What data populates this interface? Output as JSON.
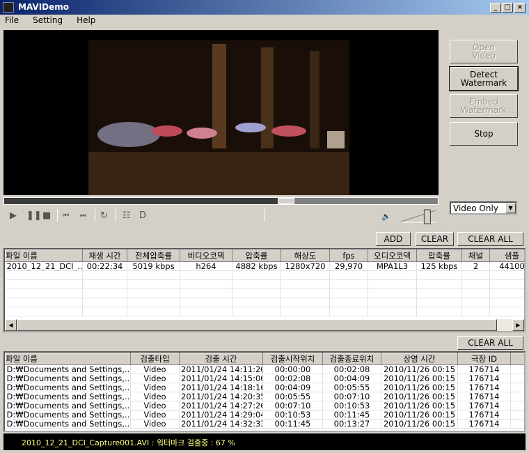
{
  "window": {
    "title": "MAVIDemo",
    "minimize": "_",
    "maximize": "□",
    "close": "×"
  },
  "menu": [
    "File",
    "Setting",
    "Help"
  ],
  "player": {
    "seek_percent": 67,
    "volume_percent": 85,
    "icons": [
      "play-icon",
      "pause-icon",
      "stop-icon",
      "prev-icon",
      "next-icon",
      "repeat-icon",
      "playlist-icon",
      "d-icon",
      "volume-icon"
    ],
    "d_label": "D"
  },
  "right_panel": {
    "open_video": "Open\nVideo",
    "detect_watermark": "Detect\nWatermark",
    "embed_watermark": "Embed\nWatermark",
    "stop": "Stop",
    "mode_select": "Video Only"
  },
  "file_list": {
    "buttons": {
      "add": "ADD",
      "clear": "CLEAR",
      "clear_all": "CLEAR ALL"
    },
    "columns": [
      "파일 이름",
      "재생 시간",
      "전체압축률",
      "비디오코덱",
      "압축률",
      "해상도",
      "fps",
      "오디오코덱",
      "압축률",
      "채널",
      "샘플"
    ],
    "rows": [
      [
        "2010_12_21_DCI_...",
        "00:22:34",
        "5019 kbps",
        "h264",
        "4882 kbps",
        "1280x720",
        "29,970",
        "MPA1L3",
        "125 kbps",
        "2",
        "44100"
      ]
    ]
  },
  "detect_list": {
    "clear_all": "CLEAR ALL",
    "columns": [
      "파일 이름",
      "검출타입",
      "검출 시간",
      "검출시작위치",
      "검출종료위치",
      "상영 시간",
      "극장 ID"
    ],
    "rows": [
      [
        "D:₩Documents and Settings,..",
        "Video",
        "2011/01/24 14:11:20",
        "00:00:00",
        "00:02:08",
        "2010/11/26 00:15",
        "176714"
      ],
      [
        "D:₩Documents and Settings,..",
        "Video",
        "2011/01/24 14:15:00",
        "00:02:08",
        "00:04:09",
        "2010/11/26 00:15",
        "176714"
      ],
      [
        "D:₩Documents and Settings,..",
        "Video",
        "2011/01/24 14:18:16",
        "00:04:09",
        "00:05:55",
        "2010/11/26 00:15",
        "176714"
      ],
      [
        "D:₩Documents and Settings,..",
        "Video",
        "2011/01/24 14:20:35",
        "00:05:55",
        "00:07:10",
        "2010/11/26 00:15",
        "176714"
      ],
      [
        "D:₩Documents and Settings,..",
        "Video",
        "2011/01/24 14:27:26",
        "00:07:10",
        "00:10:53",
        "2010/11/26 00:15",
        "176714"
      ],
      [
        "D:₩Documents and Settings,..",
        "Video",
        "2011/01/24 14:29:04",
        "00:10:53",
        "00:11:45",
        "2010/11/26 00:15",
        "176714"
      ],
      [
        "D:₩Documents and Settings,..",
        "Video",
        "2011/01/24 14:32:33",
        "00:11:45",
        "00:13:27",
        "2010/11/26 00:15",
        "176714"
      ]
    ]
  },
  "status": "2010_12_21_DCI_Capture001.AVI : 워터마크 검출중 : 67 %"
}
